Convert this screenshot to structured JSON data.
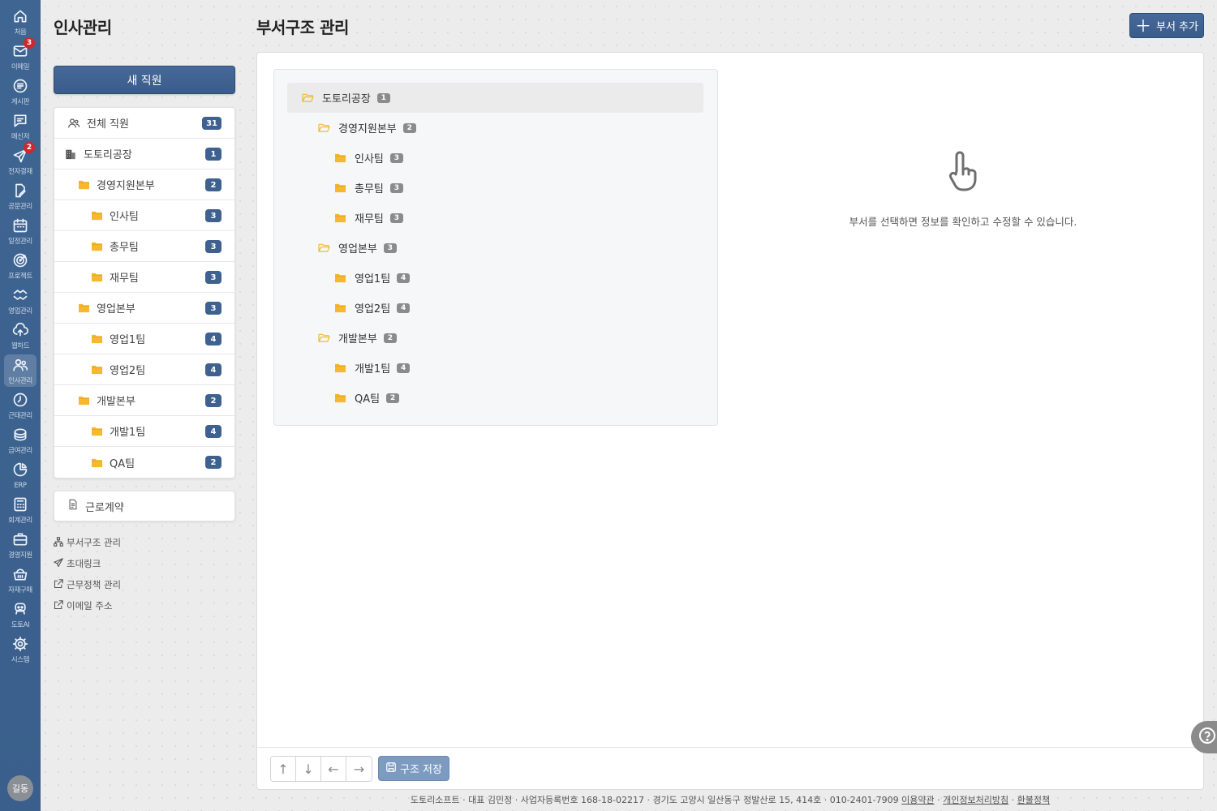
{
  "rail": {
    "items": [
      {
        "label": "처음",
        "icon": "home-icon"
      },
      {
        "label": "이메일",
        "icon": "mail-icon",
        "badge": "3"
      },
      {
        "label": "게시판",
        "icon": "board-icon"
      },
      {
        "label": "메신저",
        "icon": "messenger-icon"
      },
      {
        "label": "전자결재",
        "icon": "send-icon",
        "badge": "2"
      },
      {
        "label": "공문관리",
        "icon": "document-edit-icon"
      },
      {
        "label": "일정관리",
        "icon": "calendar-icon"
      },
      {
        "label": "프로젝트",
        "icon": "target-icon"
      },
      {
        "label": "영업관리",
        "icon": "handshake-icon"
      },
      {
        "label": "웹하드",
        "icon": "cloud-upload-icon"
      },
      {
        "label": "인사관리",
        "icon": "people-icon",
        "active": true
      },
      {
        "label": "근태관리",
        "icon": "clock-icon"
      },
      {
        "label": "급여관리",
        "icon": "coins-icon"
      },
      {
        "label": "ERP",
        "icon": "pie-chart-icon"
      },
      {
        "label": "회계관리",
        "icon": "calculator-icon"
      },
      {
        "label": "경영지원",
        "icon": "briefcase-icon"
      },
      {
        "label": "자재구매",
        "icon": "basket-icon"
      },
      {
        "label": "도토AI",
        "icon": "robot-icon"
      },
      {
        "label": "시스템",
        "icon": "gear-icon"
      }
    ],
    "user_initials": "길동"
  },
  "sidebar": {
    "title": "인사관리",
    "new_button": "새 직원",
    "departments": [
      {
        "label": "전체 직원",
        "count": "31",
        "level": 0,
        "icon": "people-icon"
      },
      {
        "label": "도토리공장",
        "count": "1",
        "level": 0,
        "icon": "building-icon"
      },
      {
        "label": "경영지원본부",
        "count": "2",
        "level": 1,
        "icon": "folder-icon"
      },
      {
        "label": "인사팀",
        "count": "3",
        "level": 2,
        "icon": "folder-icon"
      },
      {
        "label": "총무팀",
        "count": "3",
        "level": 2,
        "icon": "folder-icon"
      },
      {
        "label": "재무팀",
        "count": "3",
        "level": 2,
        "icon": "folder-icon"
      },
      {
        "label": "영업본부",
        "count": "3",
        "level": 1,
        "icon": "folder-icon"
      },
      {
        "label": "영업1팀",
        "count": "4",
        "level": 2,
        "icon": "folder-icon"
      },
      {
        "label": "영업2팀",
        "count": "4",
        "level": 2,
        "icon": "folder-icon"
      },
      {
        "label": "개발본부",
        "count": "2",
        "level": 1,
        "icon": "folder-icon"
      },
      {
        "label": "개발1팀",
        "count": "4",
        "level": 2,
        "icon": "folder-icon"
      },
      {
        "label": "QA팀",
        "count": "2",
        "level": 2,
        "icon": "folder-icon"
      }
    ],
    "contract": "근로계약",
    "links": [
      {
        "label": "부서구조 관리",
        "icon": "org-chart-icon"
      },
      {
        "label": "초대링크",
        "icon": "send-icon"
      },
      {
        "label": "근무정책 관리",
        "icon": "external-link-icon"
      },
      {
        "label": "이메일 주소",
        "icon": "external-link-icon"
      }
    ]
  },
  "main": {
    "title": "부서구조 관리",
    "add_button": "부서 추가",
    "tree": [
      {
        "label": "도토리공장",
        "count": "1",
        "level": 0,
        "open": true
      },
      {
        "label": "경영지원본부",
        "count": "2",
        "level": 1,
        "open": true
      },
      {
        "label": "인사팀",
        "count": "3",
        "level": 2,
        "open": false
      },
      {
        "label": "총무팀",
        "count": "3",
        "level": 2,
        "open": false
      },
      {
        "label": "재무팀",
        "count": "3",
        "level": 2,
        "open": false
      },
      {
        "label": "영업본부",
        "count": "3",
        "level": 1,
        "open": true
      },
      {
        "label": "영업1팀",
        "count": "4",
        "level": 2,
        "open": false
      },
      {
        "label": "영업2팀",
        "count": "4",
        "level": 2,
        "open": false
      },
      {
        "label": "개발본부",
        "count": "2",
        "level": 1,
        "open": true
      },
      {
        "label": "개발1팀",
        "count": "4",
        "level": 2,
        "open": false
      },
      {
        "label": "QA팀",
        "count": "2",
        "level": 2,
        "open": false
      }
    ],
    "hint": "부서를 선택하면 정보를 확인하고 수정할 수 있습니다.",
    "save_button": "구조 저장",
    "arrows": [
      "↑",
      "↓",
      "←",
      "→"
    ]
  },
  "footer": {
    "text": "도토리소프트 · 대표 김민정 · 사업자등록번호 168-18-02217 · 경기도 고양시 일산동구 정발산로 15, 414호 · 010-2401-7909 ",
    "links": [
      "이용약관",
      "개인정보처리방침",
      "환불정책"
    ],
    "separator": " · "
  },
  "colors": {
    "rail": "#3f6592",
    "accent": "#3e6190",
    "folder": "#f5b82e",
    "badge_red": "#d0262d"
  }
}
